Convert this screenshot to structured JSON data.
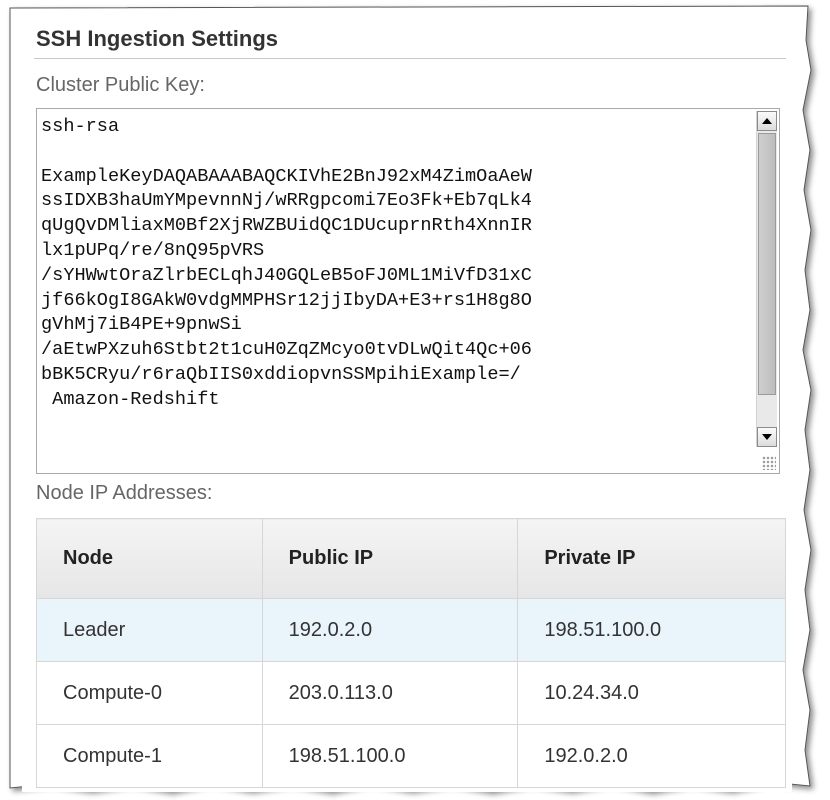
{
  "section": {
    "title": "SSH Ingestion Settings"
  },
  "cluster_key": {
    "label": "Cluster Public Key:",
    "value": "ssh-rsa\n\nExampleKeyDAQABAAABAQCKIVhE2BnJ92xM4ZimOaAeW\nssIDXB3haUmYMpevnnNj/wRRgpcomi7Eo3Fk+Eb7qLk4\nqUgQvDMliaxM0Bf2XjRWZBUidQC1DUcuprnRth4XnnIR\nlx1pUPq/re/8nQ95pVRS\n/sYHWwtOraZlrbECLqhJ40GQLeB5oFJ0ML1MiVfD31xC\njf66kOgI8GAkW0vdgMMPHSr12jjIbyDA+E3+rs1H8g8O\ngVhMj7iB4PE+9pnwSi\n/aEtwPXzuh6Stbt2t1cuH0ZqZMcyo0tvDLwQit4Qc+06\nbBK5CRyu/r6raQbIIS0xddiopvnSSMpihiExample=/\n Amazon-Redshift"
  },
  "nodes": {
    "label": "Node IP Addresses:",
    "headers": [
      "Node",
      "Public IP",
      "Private IP"
    ],
    "rows": [
      [
        "Leader",
        "192.0.2.0",
        "198.51.100.0"
      ],
      [
        "Compute-0",
        "203.0.113.0",
        "10.24.34.0"
      ],
      [
        "Compute-1",
        "198.51.100.0",
        "192.0.2.0"
      ]
    ]
  },
  "colors": {
    "title": "#333333",
    "label": "#666666",
    "header_bg": "#ececec",
    "highlight_row": "#eaf4fb",
    "border": "#d6d6d6"
  }
}
